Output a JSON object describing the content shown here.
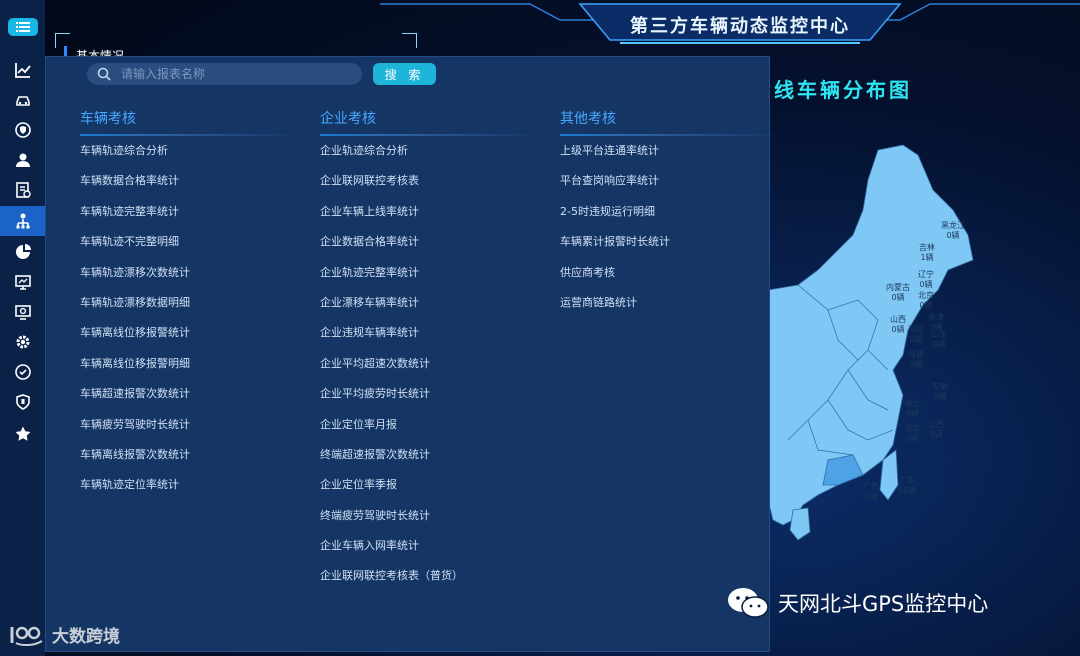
{
  "header": {
    "title": "第三方车辆动态监控中心"
  },
  "background": {
    "section_label": "基本情况",
    "map_title": "线车辆分布图"
  },
  "search": {
    "placeholder": "请输入报表名称",
    "button": "搜 索"
  },
  "sidebar": {
    "icons": [
      "menu-icon",
      "trend-chart-icon",
      "car-icon",
      "shield-lock-icon",
      "user-icon",
      "report-icon",
      "tree-icon",
      "pie-chart-icon",
      "monitor-icon",
      "screen-search-icon",
      "gear-icon",
      "refresh-shield-icon",
      "shield-icon",
      "star-icon"
    ],
    "active_index": 5
  },
  "columns": [
    {
      "title": "车辆考核",
      "items": [
        "车辆轨迹综合分析",
        "车辆数据合格率统计",
        "车辆轨迹完整率统计",
        "车辆轨迹不完整明细",
        "车辆轨迹漂移次数统计",
        "车辆轨迹漂移数据明细",
        "车辆离线位移报警统计",
        "车辆离线位移报警明细",
        "车辆超速报警次数统计",
        "车辆疲劳驾驶时长统计",
        "车辆离线报警次数统计",
        "车辆轨迹定位率统计"
      ]
    },
    {
      "title": "企业考核",
      "items": [
        "企业轨迹综合分析",
        "企业联网联控考核表",
        "企业车辆上线率统计",
        "企业数据合格率统计",
        "企业轨迹完整率统计",
        "企业漂移车辆率统计",
        "企业违规车辆率统计",
        "企业平均超速次数统计",
        "企业平均疲劳时长统计",
        "企业定位率月报",
        "终端超速报警次数统计",
        "企业定位率季报",
        "终端疲劳驾驶时长统计",
        "企业车辆入网率统计",
        "企业联网联控考核表（普货）"
      ]
    },
    {
      "title": "其他考核",
      "items": [
        "上级平台连通率统计",
        "平台查岗响应率统计",
        "2-5时违规运行明细",
        "车辆累计报警时长统计",
        "供应商考核",
        "运营商链路统计"
      ]
    }
  ],
  "map": {
    "provinces": [
      {
        "name": "黑龙江",
        "count": "0辆"
      },
      {
        "name": "吉林",
        "count": "1辆"
      },
      {
        "name": "辽宁",
        "count": "0辆"
      },
      {
        "name": "内蒙古",
        "count": "0辆"
      },
      {
        "name": "北京",
        "count": "0辆"
      },
      {
        "name": "天津",
        "count": "0辆"
      },
      {
        "name": "山西",
        "count": "0辆"
      },
      {
        "name": "河北",
        "count": "0辆"
      },
      {
        "name": "山东",
        "count": "0辆"
      },
      {
        "name": "河南",
        "count": "0辆"
      },
      {
        "name": "安徽",
        "count": "0辆"
      },
      {
        "name": "湖北",
        "count": "0辆"
      },
      {
        "name": "湖南",
        "count": "0辆"
      },
      {
        "name": "江西",
        "count": "0辆"
      },
      {
        "name": "广东",
        "count": "65辆"
      },
      {
        "name": "广西",
        "count": "0辆"
      }
    ],
    "colors": {
      "land": "#7fc8f5",
      "highlight": "#4da3e6",
      "border": "#2f6ea8"
    }
  },
  "footer": {
    "wechat": "天网北斗GPS监控中心",
    "watermark": "大数跨境"
  }
}
